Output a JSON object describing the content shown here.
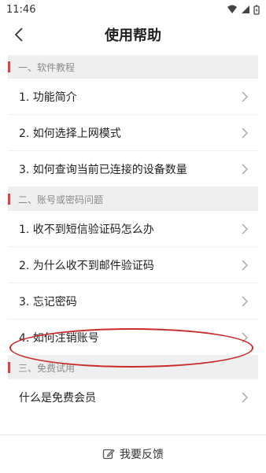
{
  "status": {
    "time": "11:46"
  },
  "header": {
    "title": "使用帮助"
  },
  "sections": [
    {
      "title": "一、软件教程",
      "items": [
        "1. 功能简介",
        "2. 如何选择上网模式",
        "3. 如何查询当前已连接的设备数量"
      ]
    },
    {
      "title": "二、账号或密码问题",
      "items": [
        "1. 收不到短信验证码怎么办",
        "2. 为什么收不到邮件验证码",
        "3. 忘记密码",
        "4. 如何注销账号"
      ]
    },
    {
      "title": "三、免费试用",
      "items": [
        "什么是免费会员"
      ]
    }
  ],
  "footer": {
    "feedback_label": "我要反馈"
  },
  "colors": {
    "accent": "#c94b4b",
    "highlight": "#c92b2b"
  },
  "icons": [
    "wifi-icon",
    "signal-icon",
    "battery-icon",
    "back-arrow-icon",
    "chevron-right-icon",
    "edit-icon"
  ]
}
